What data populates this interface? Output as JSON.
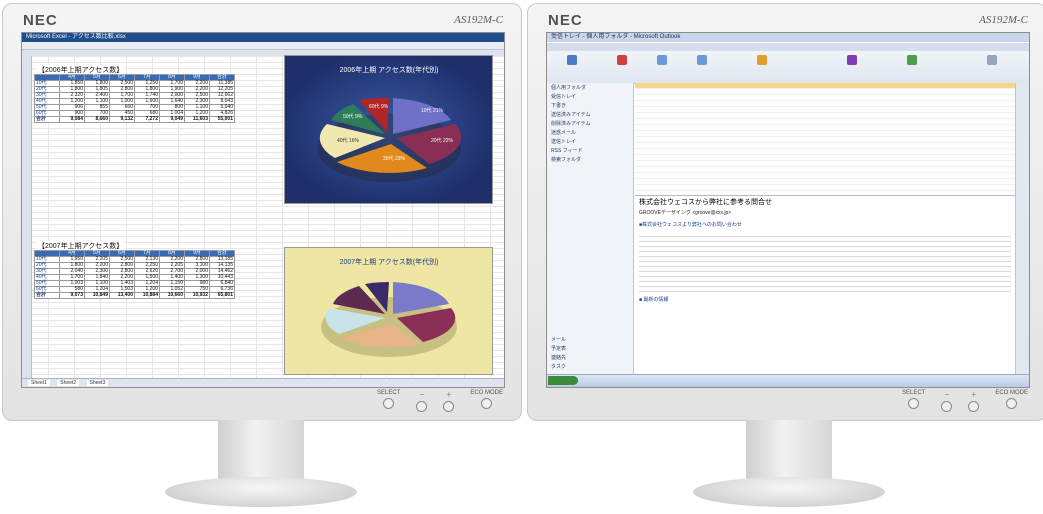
{
  "left_monitor": {
    "brand": "NEC",
    "model": "AS192M-C",
    "controls": [
      "SELECT",
      "－",
      "＋",
      "ECO MODE"
    ],
    "excel": {
      "window_title": "Microsoft Excel - アクセス数比較.xlsx",
      "sheet_tabs": [
        "Sheet1",
        "Sheet2",
        "Sheet3"
      ],
      "table1": {
        "title": "【2006年上期アクセス数】",
        "headers": [
          "",
          "4月",
          "5月",
          "6月",
          "7月",
          "8月",
          "9月",
          "合計"
        ],
        "rows": [
          [
            "10代",
            "1,850",
            "1,800",
            "2,500",
            "1,250",
            "1,700",
            "2,200",
            "11,385"
          ],
          [
            "20代",
            "1,800",
            "1,805",
            "2,800",
            "1,800",
            "1,900",
            "2,200",
            "12,205"
          ],
          [
            "30代",
            "2,320",
            "2,400",
            "1,700",
            "1,740",
            "2,000",
            "2,500",
            "12,662"
          ],
          [
            "40代",
            "1,200",
            "1,100",
            "1,000",
            "1,600",
            "1,640",
            "2,300",
            "8,643"
          ],
          [
            "50代",
            "906",
            "855",
            "660",
            "700",
            "800",
            "1,100",
            "5,040"
          ],
          [
            "60代",
            "900",
            "700",
            "450",
            "680",
            "1,004",
            "1,200",
            "4,826"
          ],
          [
            "合計",
            "9,084",
            "8,660",
            "9,132",
            "7,272",
            "9,049",
            "11,603",
            "55,001"
          ]
        ]
      },
      "table2": {
        "title": "【2007年上期アクセス数】",
        "headers": [
          "",
          "4月",
          "5月",
          "6月",
          "7月",
          "8月",
          "9月",
          "合計"
        ],
        "rows": [
          [
            "10代",
            "1,950",
            "2,205",
            "2,500",
            "2,130",
            "2,200",
            "2,800",
            "13,185"
          ],
          [
            "20代",
            "1,800",
            "2,200",
            "2,800",
            "2,250",
            "2,205",
            "3,100",
            "14,135"
          ],
          [
            "30代",
            "2,040",
            "2,300",
            "2,800",
            "2,620",
            "2,700",
            "2,000",
            "14,462"
          ],
          [
            "40代",
            "1,700",
            "1,840",
            "2,200",
            "1,500",
            "1,400",
            "1,300",
            "10,443"
          ],
          [
            "50代",
            "1,003",
            "1,100",
            "1,403",
            "1,204",
            "1,150",
            "980",
            "6,840"
          ],
          [
            "60代",
            "580",
            "1,204",
            "1,503",
            "1,200",
            "1,052",
            "750",
            "6,736"
          ],
          [
            "合計",
            "9,073",
            "10,849",
            "13,400",
            "10,884",
            "10,660",
            "10,932",
            "65,801"
          ]
        ]
      },
      "chart1": {
        "title": "2006年上期 アクセス数(年代別)",
        "slice_labels": [
          "10代\n21%",
          "20代\n22%",
          "30代\n23%",
          "40代\n16%",
          "50代\n9%",
          "60代\n9%"
        ]
      },
      "chart2": {
        "title": "2007年上期 アクセス数(年代別)"
      }
    }
  },
  "right_monitor": {
    "brand": "NEC",
    "model": "AS192M-C",
    "controls": [
      "SELECT",
      "－",
      "＋",
      "ECO MODE"
    ],
    "outlook": {
      "window_title": "受信トレイ - 個人用フォルダ - Microsoft Outlook",
      "nav_items": [
        "個人用フォルダ",
        "受信トレイ",
        "下書き",
        "送信済みアイテム",
        "削除済みアイテム",
        "迷惑メール",
        "送信トレイ",
        "RSS フィード",
        "検索フォルダ"
      ],
      "nav_buttons": [
        "メール",
        "予定表",
        "連絡先",
        "タスク"
      ],
      "email_subject": "株式会社ウェコスから弊社に参考る問合せ",
      "sender": "GROOVEデーザイング <groove@xxx.jp>",
      "body_heading": "■株式会社ウェコスより弊社へのお問い合わせ",
      "body_section2": "■ 最新の情報"
    }
  }
}
